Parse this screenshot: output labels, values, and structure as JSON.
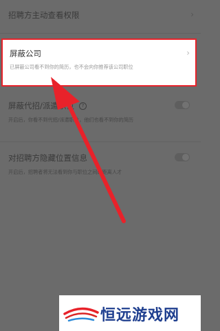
{
  "settings": {
    "employer_view": {
      "title": "招聘方主动查看权限"
    },
    "block_company": {
      "title": "屏蔽公司",
      "description": "已屏蔽公司看不到你的简历，也不会向你推荐该公司职位"
    },
    "block_agency": {
      "title": "屏蔽代招/派遣职位",
      "description": "开启后，你看不到代招/派遣职位，他们也看不到你的简历"
    },
    "hide_location": {
      "title": "对招聘方隐藏位置信息",
      "description": "开启后，招聘者将无法看到你与职位之间的距离人才"
    }
  },
  "watermark": {
    "text": "恒远游戏网"
  },
  "colors": {
    "highlight": "#e8222a",
    "arrow": "#e8222a",
    "watermark": "#1f3f8f"
  }
}
